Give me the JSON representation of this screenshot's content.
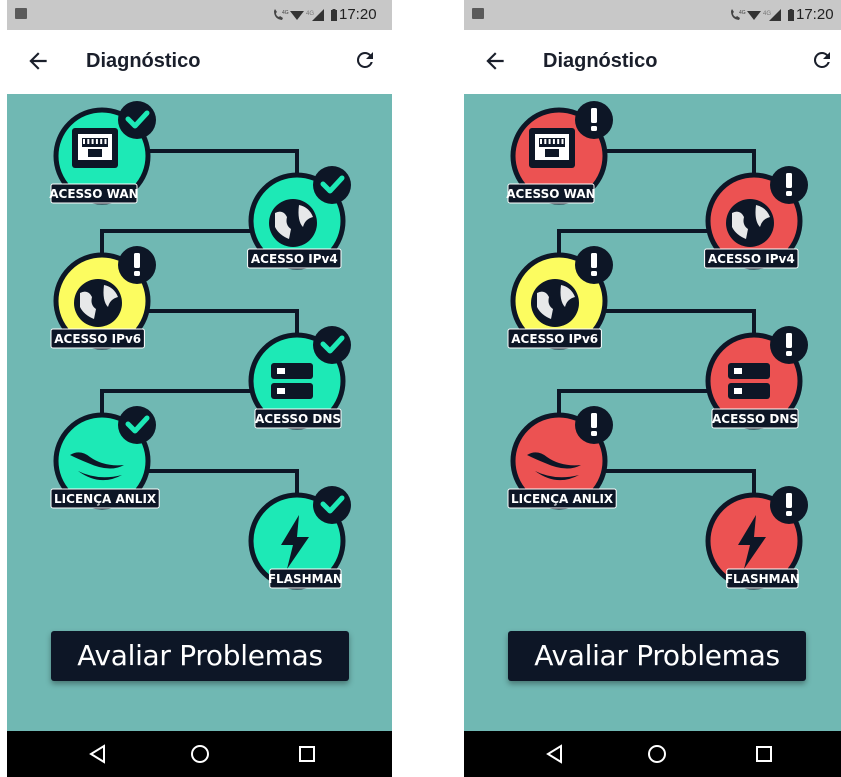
{
  "colors": {
    "background": "#70b8b3",
    "ok": "#1de9b6",
    "warning": "#fcfc60",
    "error": "#ec5252",
    "dark": "#0d1626"
  },
  "status_bar": {
    "time": "17:20",
    "network": "4G"
  },
  "app_bar": {
    "title": "Diagnóstico",
    "back_icon": "arrow-left-icon",
    "refresh_icon": "refresh-icon"
  },
  "screens": [
    {
      "nodes": [
        {
          "label": "ACESSO WAN",
          "icon": "ethernet-port-icon",
          "status": "ok"
        },
        {
          "label": "ACESSO IPv4",
          "icon": "globe-icon",
          "status": "ok"
        },
        {
          "label": "ACESSO IPv6",
          "icon": "globe-icon",
          "status": "warning"
        },
        {
          "label": "ACESSO DNS",
          "icon": "server-icon",
          "status": "ok"
        },
        {
          "label": "LICENÇA ANLIX",
          "icon": "lizard-icon",
          "status": "ok"
        },
        {
          "label": "FLASHMAN",
          "icon": "lightning-icon",
          "status": "ok"
        }
      ],
      "button_label": "Avaliar Problemas"
    },
    {
      "nodes": [
        {
          "label": "ACESSO WAN",
          "icon": "ethernet-port-icon",
          "status": "error"
        },
        {
          "label": "ACESSO IPv4",
          "icon": "globe-icon",
          "status": "error"
        },
        {
          "label": "ACESSO IPv6",
          "icon": "globe-icon",
          "status": "warning"
        },
        {
          "label": "ACESSO DNS",
          "icon": "server-icon",
          "status": "error"
        },
        {
          "label": "LICENÇA ANLIX",
          "icon": "lizard-icon",
          "status": "error"
        },
        {
          "label": "FLASHMAN",
          "icon": "lightning-icon",
          "status": "error"
        }
      ],
      "button_label": "Avaliar Problemas"
    }
  ],
  "nav_bar": {
    "icons": [
      "back-triangle-icon",
      "home-circle-icon",
      "recents-square-icon"
    ]
  }
}
